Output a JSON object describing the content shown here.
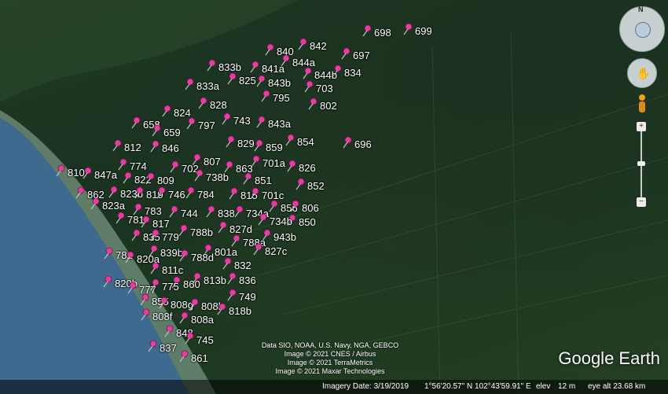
{
  "app": "Google Earth",
  "compass_label": "N",
  "attribution": [
    "Data SIO, NOAA, U.S. Navy, NGA, GEBCO",
    "Image © 2021 CNES / Airbus",
    "Image © 2021 TerraMetrics",
    "Image © 2021 Maxar Technologies"
  ],
  "logo": "Google Earth",
  "status": {
    "imagery_date": "Imagery Date: 3/19/2019",
    "coords": "1°56'20.57\" N  102°43'59.91\" E",
    "elev_label": "elev",
    "elev": "12 m",
    "eye_alt": "eye alt  23.68 km"
  },
  "markers": [
    "698",
    "699",
    "842",
    "840",
    "697",
    "844a",
    "833b",
    "841a",
    "834",
    "844b",
    "825",
    "843b",
    "833a",
    "703",
    "795",
    "802",
    "828",
    "824",
    "743",
    "843a",
    "797",
    "658",
    "659",
    "696",
    "829",
    "854",
    "812",
    "846",
    "859",
    "807",
    "701a",
    "702",
    "774",
    "863",
    "826",
    "810",
    "847a",
    "822",
    "809",
    "738b",
    "852",
    "851",
    "862",
    "823b",
    "819",
    "746",
    "784",
    "815",
    "701c",
    "823a",
    "783",
    "856",
    "806",
    "744",
    "838",
    "734a",
    "781",
    "817",
    "850",
    "835",
    "779",
    "788b",
    "827d",
    "734b",
    "943b",
    "788a",
    "782",
    "820a",
    "839b",
    "801a",
    "827c",
    "788d",
    "811c",
    "832",
    "860",
    "836",
    "820b",
    "777",
    "775",
    "813b",
    "749",
    "855",
    "808g",
    "808b",
    "818b",
    "808f",
    "808a",
    "848",
    "745",
    "837",
    "861"
  ]
}
